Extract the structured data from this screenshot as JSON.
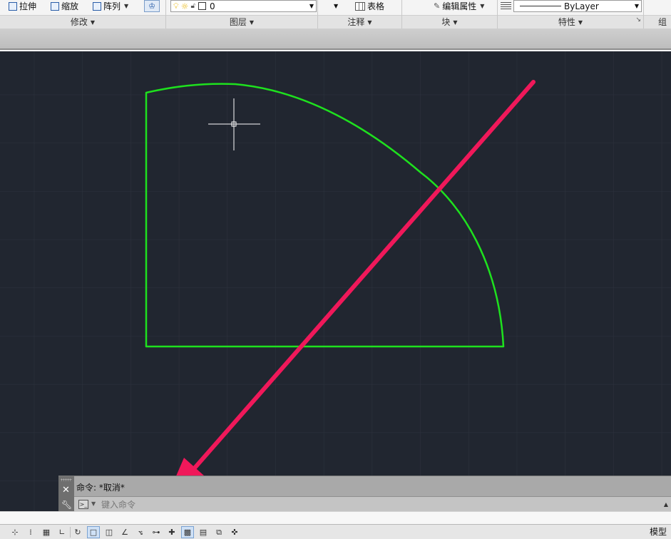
{
  "ribbon": {
    "modify": {
      "items": [
        {
          "label": "拉伸",
          "icon": "stretch-icon"
        },
        {
          "label": "缩放",
          "icon": "scale-icon"
        },
        {
          "label": "阵列",
          "icon": "array-icon"
        }
      ],
      "title": "修改"
    },
    "layers": {
      "current_layer": "0",
      "title": "图层"
    },
    "annotation": {
      "table_label": "表格",
      "title": "注释"
    },
    "block": {
      "edit_attributes_label": "编辑属性",
      "title": "块"
    },
    "properties": {
      "linetype_value": "ByLayer",
      "title": "特性"
    },
    "group": {
      "title": "组"
    }
  },
  "command_line": {
    "history": "命令: *取消*",
    "placeholder": "键入命令"
  },
  "statusbar": {
    "model_label": "模型"
  },
  "colors": {
    "canvas_bg": "#212630",
    "grid": "#2c323d",
    "geometry": "#1ee11e",
    "annotation_arrow": "#f0185a",
    "crosshair": "#ffffff"
  }
}
